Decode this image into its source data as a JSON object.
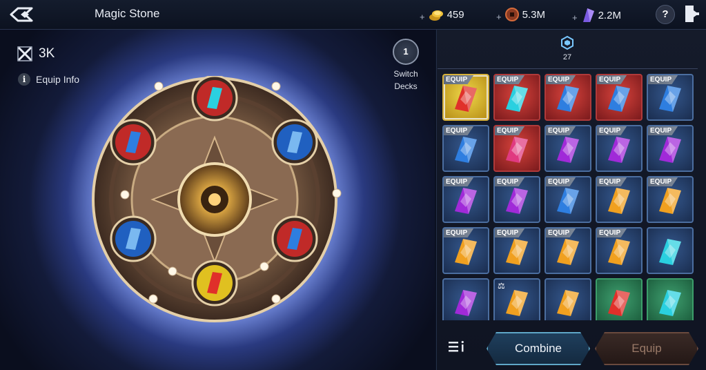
{
  "header": {
    "title": "Magic Stone",
    "currencies": [
      {
        "icon": "gold-coin-icon",
        "value": "459"
      },
      {
        "icon": "bronze-coin-icon",
        "value": "5.3M"
      },
      {
        "icon": "purple-crystal-icon",
        "value": "2.2M"
      }
    ],
    "help_label": "?"
  },
  "left": {
    "power_value": "3K",
    "equip_info_label": "Equip Info",
    "switch_label": "Switch Decks",
    "switch_deck_number": "1"
  },
  "inventory": {
    "slot_count": "27",
    "equip_tag": "EQUIP",
    "tiles": [
      {
        "color": "gold",
        "gem": "red",
        "equipped": true,
        "selected": true
      },
      {
        "color": "red",
        "gem": "cyan",
        "equipped": true
      },
      {
        "color": "red",
        "gem": "blue",
        "equipped": true
      },
      {
        "color": "red",
        "gem": "blue",
        "equipped": true
      },
      {
        "color": "blue",
        "gem": "blue",
        "equipped": true
      },
      {
        "color": "blue",
        "gem": "blue",
        "equipped": true
      },
      {
        "color": "red",
        "gem": "pink",
        "equipped": true
      },
      {
        "color": "blue",
        "gem": "purple",
        "equipped": true
      },
      {
        "color": "blue",
        "gem": "purple",
        "equipped": true
      },
      {
        "color": "blue",
        "gem": "purple",
        "equipped": true
      },
      {
        "color": "blue",
        "gem": "purple",
        "equipped": true
      },
      {
        "color": "blue",
        "gem": "purple",
        "equipped": true
      },
      {
        "color": "blue",
        "gem": "blue",
        "equipped": true
      },
      {
        "color": "blue",
        "gem": "orange",
        "equipped": true
      },
      {
        "color": "blue",
        "gem": "orange",
        "equipped": true
      },
      {
        "color": "blue",
        "gem": "orange",
        "equipped": true
      },
      {
        "color": "blue",
        "gem": "orange",
        "equipped": true
      },
      {
        "color": "blue",
        "gem": "orange",
        "equipped": true
      },
      {
        "color": "blue",
        "gem": "orange",
        "equipped": true
      },
      {
        "color": "blue",
        "gem": "cyan",
        "equipped": false
      },
      {
        "color": "blue",
        "gem": "purple",
        "equipped": false
      },
      {
        "color": "blue",
        "gem": "orange",
        "equipped": false,
        "locked": true
      },
      {
        "color": "blue",
        "gem": "orange",
        "equipped": false
      },
      {
        "color": "green",
        "gem": "red",
        "equipped": false
      },
      {
        "color": "green",
        "gem": "cyan",
        "equipped": false
      }
    ]
  },
  "footer": {
    "combine_label": "Combine",
    "equip_label": "Equip"
  },
  "colors": {
    "gem_red": "#e0302a",
    "gem_blue": "#2e7ee0",
    "gem_cyan": "#2ad0e0",
    "gem_purple": "#a02ad8",
    "gem_pink": "#e03a80",
    "gem_orange": "#f0a020"
  }
}
